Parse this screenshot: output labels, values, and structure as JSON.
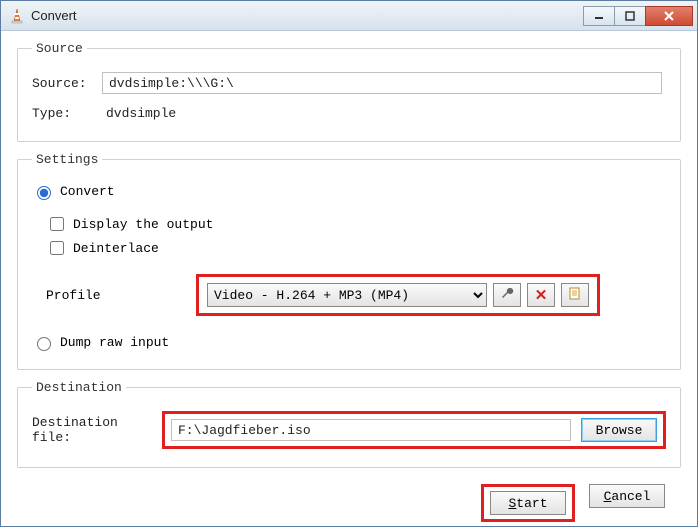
{
  "window": {
    "title": "Convert"
  },
  "source": {
    "legend": "Source",
    "source_label": "Source:",
    "source_value": "dvdsimple:\\\\\\G:\\",
    "type_label": "Type:",
    "type_value": "dvdsimple"
  },
  "settings": {
    "legend": "Settings",
    "convert_label": "Convert",
    "convert_checked": true,
    "display_output_label": "Display the output",
    "display_output_checked": false,
    "deinterlace_label": "Deinterlace",
    "deinterlace_checked": false,
    "profile_label": "Profile",
    "profile_selected": "Video - H.264 + MP3 (MP4)",
    "dump_label": "Dump raw input",
    "dump_checked": false
  },
  "destination": {
    "legend": "Destination",
    "file_label": "Destination file:",
    "file_value": "F:\\Jagdfieber.iso",
    "browse_label": "Browse"
  },
  "footer": {
    "start_label": "Start",
    "cancel_label": "Cancel"
  },
  "icons": {
    "wrench": "wrench-icon",
    "delete": "delete-icon",
    "new": "new-profile-icon"
  }
}
